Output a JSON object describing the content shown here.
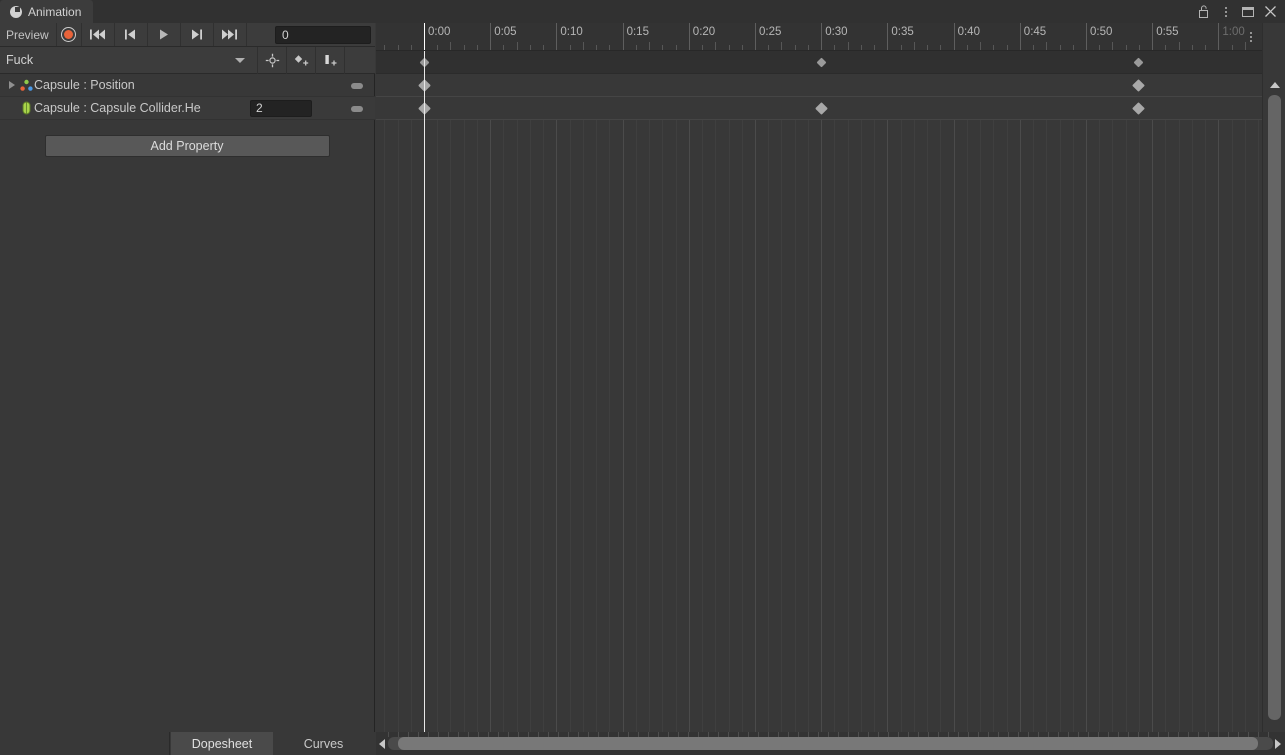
{
  "window": {
    "tab_title": "Animation",
    "tab_icon": "clock-icon",
    "controls": {
      "lock": "lock-open-icon",
      "menu": "kebab-menu-icon",
      "maximize": "maximize-icon",
      "close": "close-icon"
    }
  },
  "toolbar": {
    "preview_label": "Preview",
    "record_button": "record-icon",
    "first_frame": "skip-to-start-icon",
    "prev_frame": "step-back-icon",
    "play": "play-icon",
    "next_frame": "step-forward-icon",
    "last_frame": "skip-to-end-icon",
    "frame_value": "0"
  },
  "clip_selector": {
    "selected_clip": "Fuck",
    "dropdown_icon": "chevron-down-icon",
    "add_keyframe_pivot": "keyframe-pivot-icon",
    "add_keyframe": "add-keyframe-icon",
    "add_event": "add-event-icon"
  },
  "properties": {
    "rows": [
      {
        "label": "Capsule : Position",
        "icon": "transform-icon",
        "has_foldout": true,
        "value": null,
        "toggle": "curve-toggle-icon"
      },
      {
        "label": "Capsule : Capsule Collider.He",
        "icon": "capsule-collider-icon",
        "has_foldout": false,
        "value": "2",
        "toggle": "curve-toggle-icon"
      }
    ],
    "add_property_label": "Add Property"
  },
  "timeline": {
    "tick_labels": [
      "0:00",
      "0:05",
      "0:10",
      "0:15",
      "0:20",
      "0:25",
      "0:30",
      "0:35",
      "0:40",
      "0:45",
      "0:50",
      "0:55",
      "1:00"
    ],
    "dimmed_label": "1:00",
    "playhead_time": "0:00",
    "options_menu": "kebab-menu-icon",
    "keyframe_rows": [
      {
        "row": "summary",
        "keyframes": [
          "0:00",
          "0:30",
          "0:54"
        ]
      },
      {
        "row": "Capsule : Position",
        "keyframes": [
          "0:00",
          "0:54"
        ]
      },
      {
        "row": "Capsule : Capsule Collider.He",
        "keyframes": [
          "0:00",
          "0:30",
          "0:54"
        ]
      }
    ]
  },
  "bottom_tabs": {
    "items": [
      {
        "label": "Dopesheet",
        "active": true
      },
      {
        "label": "Curves",
        "active": false
      }
    ],
    "scroll_left": "arrow-left-icon",
    "scroll_right": "arrow-right-icon"
  },
  "scrollbars": {
    "vertical_up": "arrow-up-icon"
  },
  "colors": {
    "panel_bg": "#383838",
    "toolbar_bg": "#3c3c3c",
    "tabbar_bg": "#313131",
    "record_accent": "#e8633a",
    "keyframe": "#a8a8a8",
    "playhead": "#e8e8e8",
    "button_face": "#585858"
  }
}
